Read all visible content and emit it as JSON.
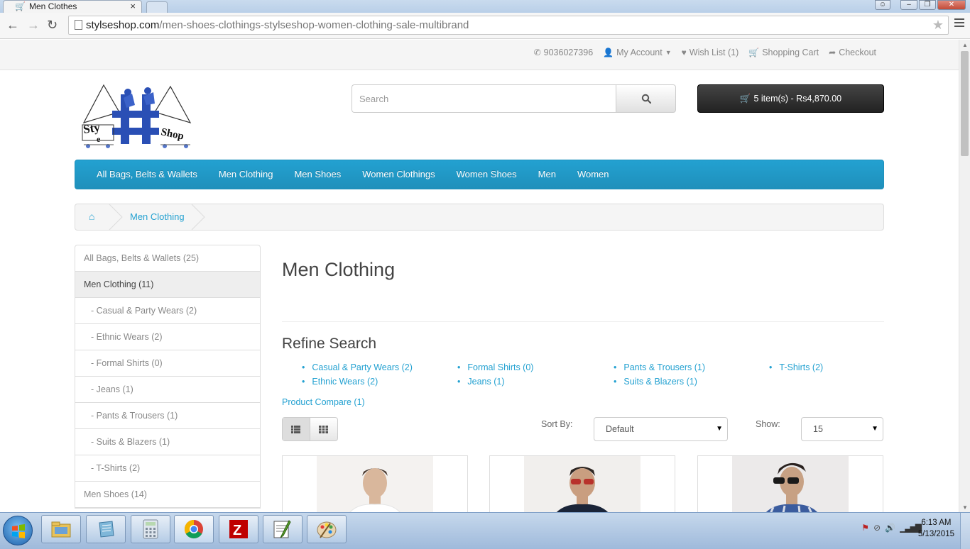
{
  "browser": {
    "tab_title": "Men Clothes",
    "tab_close": "×",
    "url_host": "stylseshop.com",
    "url_path": "/men-shoes-clothings-stylseshop-women-clothing-sale-multibrand",
    "back_icon": "←",
    "forward_icon": "→",
    "reload_icon": "↻",
    "star_icon": "★"
  },
  "topbar": {
    "phone": "9036027396",
    "my_account": "My Account",
    "wishlist": "Wish List (1)",
    "shopping_cart": "Shopping Cart",
    "checkout": "Checkout"
  },
  "header": {
    "search_placeholder": "Search",
    "cart_label": "5 item(s) - Rs4,870.00"
  },
  "menu": [
    "All Bags, Belts & Wallets",
    "Men Clothing",
    "Men Shoes",
    "Women Clothings",
    "Women Shoes",
    "Men",
    "Women"
  ],
  "breadcrumb": {
    "current": "Men Clothing"
  },
  "sidebar": [
    {
      "label": "All Bags, Belts & Wallets (25)",
      "sub": false,
      "active": false
    },
    {
      "label": "Men Clothing (11)",
      "sub": false,
      "active": true
    },
    {
      "label": "- Casual & Party Wears (2)",
      "sub": true,
      "active": false
    },
    {
      "label": "- Ethnic Wears (2)",
      "sub": true,
      "active": false
    },
    {
      "label": "- Formal Shirts (0)",
      "sub": true,
      "active": false
    },
    {
      "label": "- Jeans (1)",
      "sub": true,
      "active": false
    },
    {
      "label": "- Pants & Trousers (1)",
      "sub": true,
      "active": false
    },
    {
      "label": "- Suits & Blazers (1)",
      "sub": true,
      "active": false
    },
    {
      "label": "- T-Shirts (2)",
      "sub": true,
      "active": false
    },
    {
      "label": "Men Shoes (14)",
      "sub": false,
      "active": false
    }
  ],
  "content": {
    "title": "Men Clothing",
    "refine_title": "Refine Search",
    "refine_columns": [
      [
        "Casual & Party Wears (2)",
        "Ethnic Wears (2)"
      ],
      [
        "Formal Shirts (0)",
        "Jeans (1)"
      ],
      [
        "Pants & Trousers (1)",
        "Suits & Blazers (1)"
      ],
      [
        "T-Shirts (2)"
      ]
    ],
    "compare": "Product Compare (1)",
    "sort_label": "Sort By:",
    "sort_value": "Default",
    "show_label": "Show:",
    "show_value": "15"
  },
  "taskbar": {
    "time": "6:13 AM",
    "date": "5/13/2015"
  },
  "colors": {
    "accent": "#23a1d1",
    "cart_button": "#2b2b2b",
    "menu_bar": "#229ac8"
  }
}
